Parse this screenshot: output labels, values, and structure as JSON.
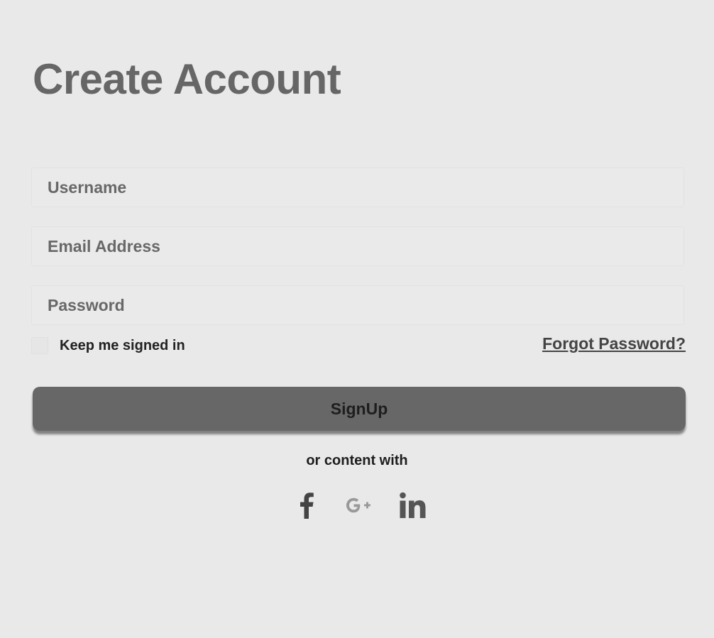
{
  "form": {
    "title": "Create Account",
    "username_placeholder": "Username",
    "email_placeholder": "Email Address",
    "password_placeholder": "Password",
    "remember_label": "Keep me signed in",
    "forgot_label": "Forgot Password?",
    "submit_label": "SignUp",
    "alt_text": "or content with"
  },
  "social": [
    {
      "name": "facebook-icon",
      "color": "#444444"
    },
    {
      "name": "google-plus-icon",
      "color": "#999999"
    },
    {
      "name": "linkedin-icon",
      "color": "#555555"
    }
  ],
  "colors": {
    "background": "#e9e9e9",
    "title": "#666666",
    "button": "#676767"
  }
}
